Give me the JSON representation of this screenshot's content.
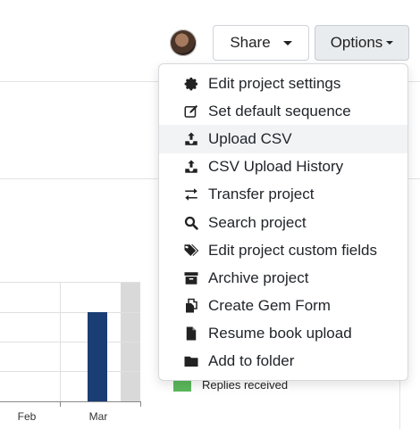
{
  "header": {
    "share_label": "Share",
    "options_label": "Options"
  },
  "menu": {
    "items": [
      {
        "label": "Edit project settings",
        "icon": "gear-icon"
      },
      {
        "label": "Set default sequence",
        "icon": "edit-icon"
      },
      {
        "label": "Upload CSV",
        "icon": "upload-icon",
        "active": true
      },
      {
        "label": "CSV Upload History",
        "icon": "upload-icon"
      },
      {
        "label": "Transfer project",
        "icon": "transfer-icon"
      },
      {
        "label": "Search project",
        "icon": "search-icon"
      },
      {
        "label": "Edit project custom fields",
        "icon": "tags-icon"
      },
      {
        "label": "Archive project",
        "icon": "archive-icon"
      },
      {
        "label": "Create Gem Form",
        "icon": "copy-icon"
      },
      {
        "label": "Resume book upload",
        "icon": "file-icon"
      },
      {
        "label": "Add to folder",
        "icon": "folder-icon"
      }
    ]
  },
  "chart_data": {
    "type": "bar",
    "categories": [
      "Feb",
      "Mar"
    ],
    "series": [
      {
        "name": "",
        "color": "#1a3d73",
        "values": [
          null,
          1
        ]
      }
    ]
  },
  "legend": {
    "items": [
      {
        "label": "Replies received",
        "color": "#5cb85c"
      }
    ]
  }
}
